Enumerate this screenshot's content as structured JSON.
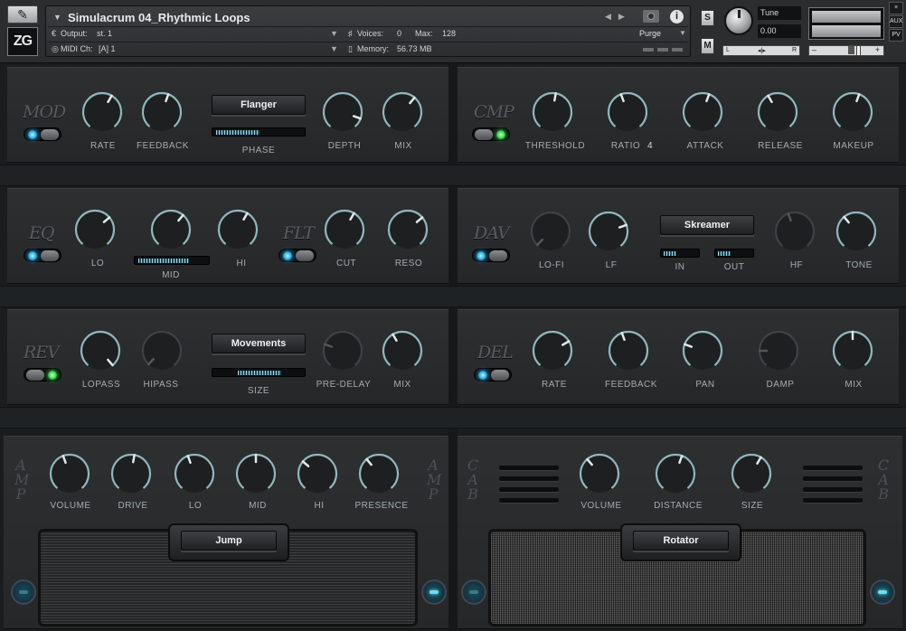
{
  "header": {
    "instrument_title": "Simulacrum 04_Rhythmic Loops",
    "logo_text": "ZG",
    "output_label": "Output:",
    "output_value": "st. 1",
    "midi_label": "MIDI Ch:",
    "midi_value": "[A]  1",
    "voices_label": "Voices:",
    "voices_value": "0",
    "max_label": "Max:",
    "max_value": "128",
    "memory_label": "Memory:",
    "memory_value": "56.73 MB",
    "purge_label": "Purge",
    "solo_label": "S",
    "mute_label": "M",
    "tune_label": "Tune",
    "tune_value": "0.00",
    "pan_left": "L",
    "pan_right": "R",
    "vol_minus": "–",
    "vol_plus": "+",
    "side_buttons": [
      "×",
      "AUX",
      "PV"
    ]
  },
  "colors": {
    "led_blue": "#29b6f6",
    "led_green": "#35e04e",
    "knob_arc": "#8fb7bd"
  },
  "modules": {
    "mod": {
      "name": "MOD",
      "led": "blue",
      "knobs": [
        "RATE",
        "FEEDBACK",
        "DEPTH",
        "MIX"
      ],
      "menu": "Flanger",
      "slider_label": "PHASE"
    },
    "cmp": {
      "name": "CMP",
      "led": "green",
      "knobs": [
        "THRESHOLD",
        "RATIO",
        "ATTACK",
        "RELEASE",
        "MAKEUP"
      ],
      "ratio_value": "4"
    },
    "eq": {
      "name": "EQ",
      "led": "blue",
      "knobs": [
        "LO",
        "HI"
      ],
      "slider_label": "MID"
    },
    "flt": {
      "name": "FLT",
      "led": "blue",
      "knobs": [
        "CUT",
        "RESO"
      ]
    },
    "dav": {
      "name": "DAV",
      "led": "blue",
      "knobs": [
        "LO-FI",
        "LF",
        "HF",
        "TONE"
      ],
      "menu": "Skreamer",
      "in_label": "IN",
      "out_label": "OUT"
    },
    "rev": {
      "name": "REV",
      "led": "green",
      "knobs": [
        "LOPASS",
        "HIPASS",
        "PRE-DELAY",
        "MIX"
      ],
      "menu": "Movements",
      "slider_label": "SIZE"
    },
    "del": {
      "name": "DEL",
      "led": "blue",
      "knobs": [
        "RATE",
        "FEEDBACK",
        "PAN",
        "DAMP",
        "MIX"
      ]
    },
    "amp": {
      "name_letters": [
        "A",
        "M",
        "P"
      ],
      "knobs": [
        "VOLUME",
        "DRIVE",
        "LO",
        "MID",
        "HI",
        "PRESENCE"
      ],
      "menu": "Jump"
    },
    "cab": {
      "name_letters": [
        "C",
        "A",
        "B"
      ],
      "knobs": [
        "VOLUME",
        "DISTANCE",
        "SIZE"
      ],
      "menu": "Rotator"
    }
  }
}
